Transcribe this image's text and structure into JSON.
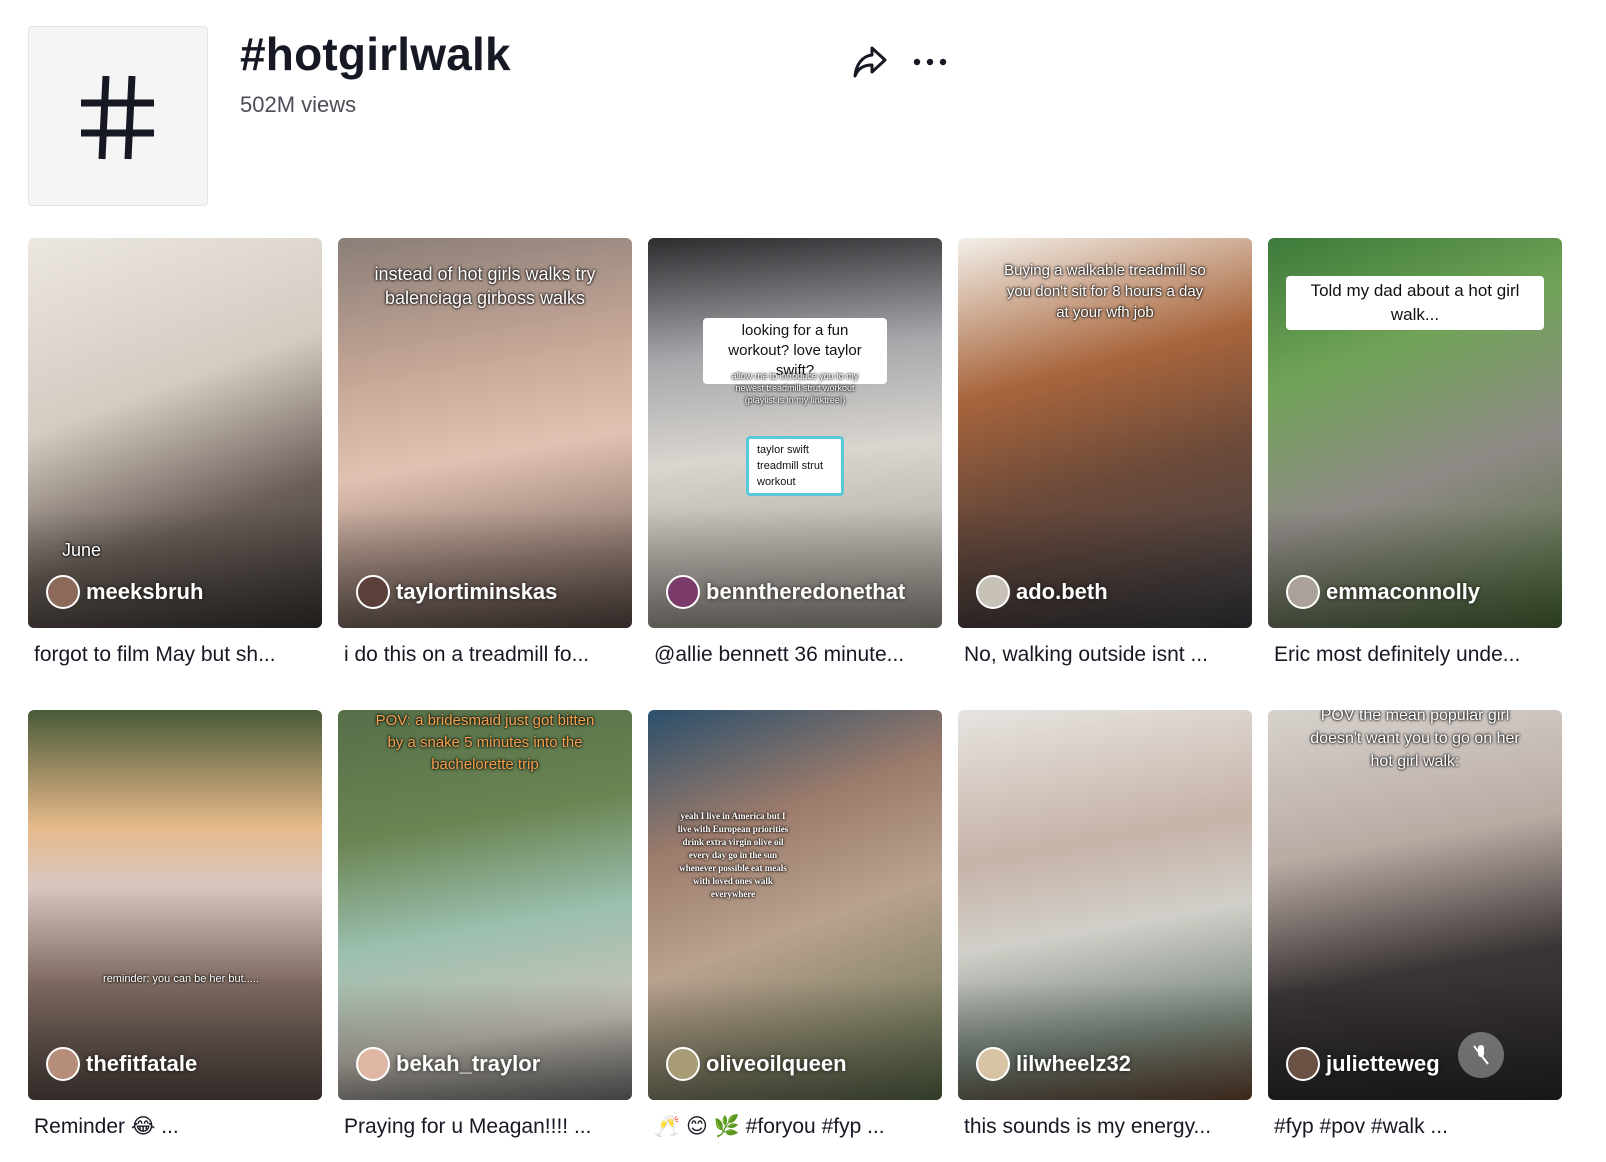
{
  "header": {
    "title": "#hotgirlwalk",
    "views": "502M views",
    "hashtag_symbol": "#",
    "share_icon": "share-arrow-icon",
    "more_icon": "more-dots-icon"
  },
  "videos": [
    {
      "author": "meeksbruh",
      "caption": "forgot to film May but sh...",
      "overlay": "June"
    },
    {
      "author": "taylortiminskas",
      "caption": "i do this on a treadmill fo...",
      "overlay": "instead of hot girls walks try balenciaga girboss walks"
    },
    {
      "author": "benntheredonethat",
      "caption": "@allie bennett 36 minute...",
      "overlay": "looking for a fun workout? love taylor swift?",
      "overlay2": "allow me to introduce you to my newest treadmill strut workout (playlist is in my linktree!)",
      "overlay3": "taylor swift treadmill strut workout"
    },
    {
      "author": "ado.beth",
      "caption": "No, walking outside isnt ...",
      "overlay": "Buying a walkable treadmill so you don't sit for 8 hours a day at your wfh job"
    },
    {
      "author": "emmaconnolly",
      "caption": "Eric most definitely unde...",
      "overlay": "Told my dad about a hot girl walk..."
    },
    {
      "author": "thefitfatale",
      "caption": "Reminder 😂 ...",
      "overlay": "reminder: you can be her but....."
    },
    {
      "author": "bekah_traylor",
      "caption": "Praying for u Meagan!!!! ...",
      "overlay": "POV: a bridesmaid just got bitten by a snake 5 minutes into the bachelorette trip"
    },
    {
      "author": "oliveoilqueen",
      "caption": "🥂 😊 🌿 #foryou #fyp ...",
      "overlay": "yeah I live in America but I live with European priorities drink extra virgin olive oil every day go in the sun whenever possible eat meals with loved ones walk everywhere"
    },
    {
      "author": "lilwheelz32",
      "caption": "this sounds is my energy...",
      "overlay": ""
    },
    {
      "author": "julietteweg",
      "caption": "#fyp #pov #walk ...",
      "overlay": "POV the mean popular girl doesn't want you to go on her hot girl walk:"
    }
  ]
}
